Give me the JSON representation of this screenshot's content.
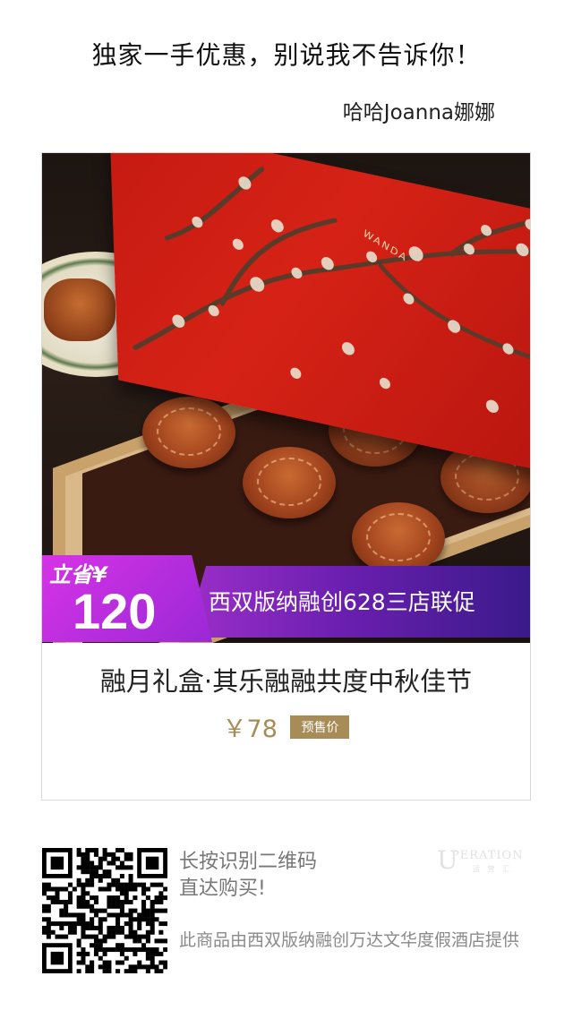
{
  "header": {
    "headline": "独家一手优惠，别说我不告诉你！",
    "author": "哈哈Joanna娜娜"
  },
  "product": {
    "box_brand": "WANDA",
    "promo_save_label": "立省¥",
    "promo_amount": "120",
    "promo_text": "西双版纳融创628三店联促",
    "title": "融月礼盒·其乐融融共度中秋佳节",
    "price": "￥78",
    "presale_label": "预售价"
  },
  "footer": {
    "qr_line1": "长按识别二维码",
    "qr_line2": "直达购买!",
    "provider_note": "此商品由西双版纳融创万达文华度假酒店提供",
    "logo_big_letter": "U",
    "logo_text": "PERATION",
    "logo_sub": "运 营 汇"
  },
  "colors": {
    "price_gold": "#a88c57",
    "promo_purple": "#9b2fc8",
    "lid_red": "#c41a12"
  }
}
